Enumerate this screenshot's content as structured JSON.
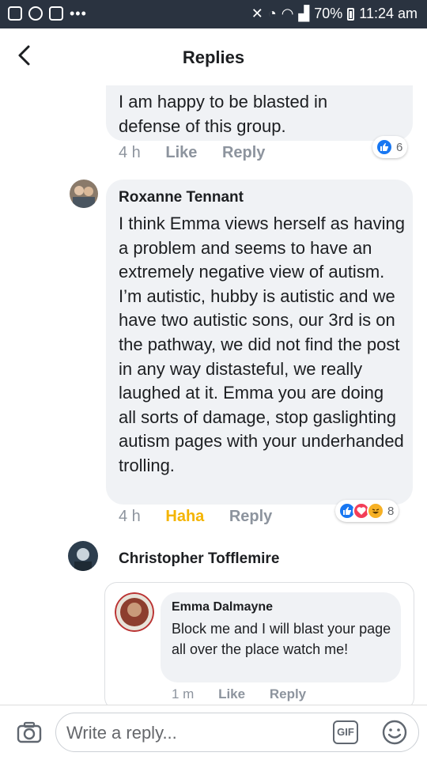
{
  "status_bar": {
    "battery": "70%",
    "time": "11:24 am"
  },
  "header": {
    "title": "Replies"
  },
  "comments": [
    {
      "text": "I am happy to be blasted in defense of this group.",
      "time": "4 h",
      "like": "Like",
      "reply": "Reply",
      "reaction_count": "6"
    },
    {
      "author": "Roxanne Tennant",
      "text": "I think Emma views herself as having a problem and seems to have an extremely negative view of autism. I’m autistic, hubby is autistic and we have two autistic sons, our 3rd is on the pathway, we did not find the post in any way distasteful, we really laughed at it. Emma you are doing all sorts of damage, stop gaslighting autism pages with your underhanded trolling.",
      "time": "4 h",
      "reaction_label": "Haha",
      "reply": "Reply",
      "reaction_count": "8"
    },
    {
      "author": "Christopher Tofflemire"
    },
    {
      "author": "Emma Dalmayne",
      "text": "Block me and I will blast your page all over the place watch me!",
      "time": "1 m",
      "like": "Like",
      "reply": "Reply"
    }
  ],
  "composer": {
    "placeholder": "Write a reply...",
    "gif_label": "GIF"
  },
  "colors": {
    "like_blue": "#1877f2",
    "love_red": "#f33e58",
    "haha_yellow": "#f7b125",
    "haha_text": "#f4b400"
  }
}
